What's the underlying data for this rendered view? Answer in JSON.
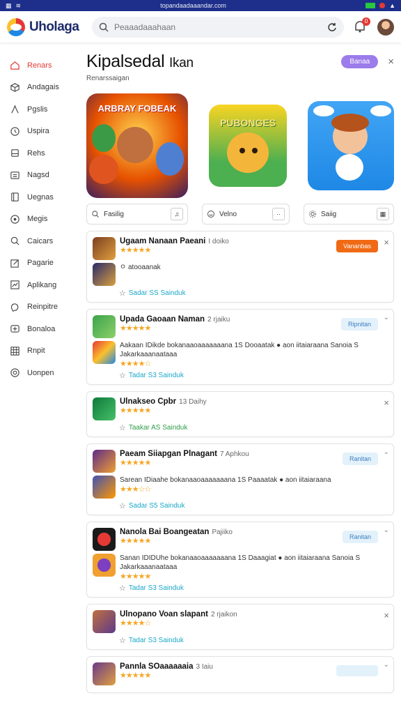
{
  "status": {
    "url": "topandaadaaandar.com"
  },
  "header": {
    "logo_text": "Uholaga",
    "search_placeholder": "Peaaadaaahaan",
    "badge_count": "0"
  },
  "sidebar": {
    "items": [
      {
        "label": "Renars",
        "icon": "home-icon",
        "active": true
      },
      {
        "label": "Andagais",
        "icon": "cube-icon"
      },
      {
        "label": "Pgslis",
        "icon": "user-icon"
      },
      {
        "label": "Uspira",
        "icon": "clock-icon"
      },
      {
        "label": "Rehs",
        "icon": "box-icon"
      },
      {
        "label": "Nagsd",
        "icon": "list-icon"
      },
      {
        "label": "Uegnas",
        "icon": "page-icon"
      },
      {
        "label": "Megis",
        "icon": "circle-icon"
      },
      {
        "label": "Caicars",
        "icon": "search-icon"
      },
      {
        "label": "Pagarie",
        "icon": "edit-icon"
      },
      {
        "label": "Aplikang",
        "icon": "chart-icon"
      },
      {
        "label": "Reinpitre",
        "icon": "chat-icon"
      },
      {
        "label": "Bonaloa",
        "icon": "gamepad-icon"
      },
      {
        "label": "Rnpit",
        "icon": "grid-icon"
      },
      {
        "label": "Uonpen",
        "icon": "target-icon"
      }
    ]
  },
  "main": {
    "title": "Kipalsedal",
    "title_suffix": "Ikan",
    "subtitle": "Renarssaigan",
    "pill_button": "Banaa",
    "featured": [
      {
        "label": "ARBRAY FOBEAK"
      },
      {
        "label": "PUBONGES"
      },
      {
        "label": ""
      }
    ],
    "chips": [
      {
        "label": "Fasilig",
        "icon": "search-icon",
        "box": "♫"
      },
      {
        "label": "Velno",
        "icon": "smile-icon",
        "box": "··"
      },
      {
        "label": "Saiig",
        "icon": "gear-icon",
        "box": "▦"
      }
    ],
    "cards": [
      {
        "title": "Ugaam Nanaan Paeani",
        "tag": "I doiko",
        "action": "Vananbas",
        "action_style": "orange",
        "end": "×",
        "stars": "★★★★★",
        "rows": [
          {
            "note": "ㅇ atooaanak"
          }
        ],
        "meta": "Sadar SS Sainduk",
        "meta_style": "blue"
      },
      {
        "title": "Upada Gaoaan Naman",
        "tag": "2 rjaiku",
        "action": "Ripnitan",
        "action_style": "light",
        "end": "⌄",
        "stars": "★★★★★",
        "rows": [
          {
            "desc": "Aakaan IDikde bokanaaoaaaaaaana 1S Dooaatak ● aon iitaiaraana Sanoia S Jakarkaaanaataaa",
            "stars": "★★★★☆"
          }
        ],
        "meta": "Tadar S3 Sainduk",
        "meta_style": "blue"
      },
      {
        "title": "Ulnakseo Cpbr",
        "tag": "13 Daihy",
        "action": "",
        "action_style": "",
        "end": "×",
        "stars": "★★★★★",
        "rows": [],
        "meta": "Taakar AS Sainduk",
        "meta_style": "green"
      },
      {
        "title": "Paeam Siiapgan Plnagant",
        "tag": "7 Aphkou",
        "action": "Ranitan",
        "action_style": "light",
        "end": "⌄",
        "stars": "★★★★★",
        "rows": [
          {
            "desc": "Sarean IDiaahe bokanaaoaaaaaaana 1S Paaaatak ● aon iitaiaraana",
            "stars": "★★★☆☆"
          }
        ],
        "meta": "Sadar S5 Sainduk",
        "meta_style": "blue"
      },
      {
        "title": "Nanola Bai Boangeatan",
        "tag": "Pajiiko",
        "action": "Ranitan",
        "action_style": "light",
        "end": "⌄",
        "stars": "★★★★★",
        "rows": [
          {
            "desc": "Sanan IDIDUhe bokanaaoaaaaaaana 1S Daaagiat ● aon iitaiaraana Sanoia S Jakarkaaanaataaa",
            "stars": "★★★★★"
          }
        ],
        "meta": "Tadar S3 Sainduk",
        "meta_style": "blue"
      },
      {
        "title": "Ulnopano Voan slapant",
        "tag": "2 rjaikon",
        "action": "",
        "action_style": "",
        "end": "×",
        "stars": "★★★★☆",
        "rows": [],
        "meta": "Tadar S3 Sainduk",
        "meta_style": "blue"
      },
      {
        "title": "Pannla SOaaaaaaia",
        "tag": "3 Iaiu",
        "action": "",
        "action_style": "light",
        "end": "⌄",
        "stars": "★★★★★",
        "rows": [],
        "meta": "",
        "meta_style": "blue"
      }
    ]
  },
  "colors": {
    "accent": "#e53935",
    "purple": "#9c7bea",
    "orange": "#f06a15",
    "link": "#1ba8c9"
  }
}
